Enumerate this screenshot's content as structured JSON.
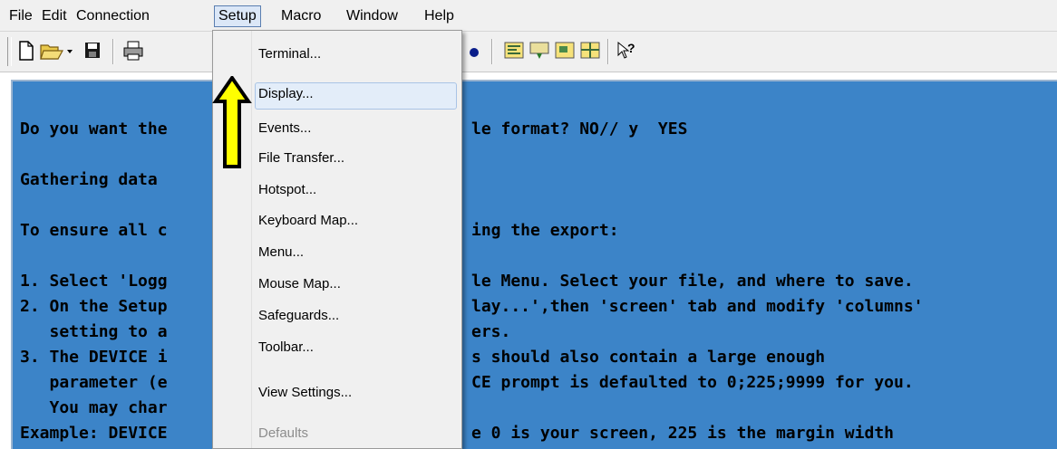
{
  "menubar": {
    "items": [
      "File",
      "Edit",
      "Connection",
      "Setup",
      "Macro",
      "Window",
      "Help"
    ],
    "active": "Setup"
  },
  "toolbar": {
    "icons": [
      "new-icon",
      "open-icon",
      "dropdown-arrow-icon",
      "save-icon",
      "print-icon",
      "dot-icon",
      "map-icon",
      "keyboard-icon",
      "hotspot-icon",
      "grid-icon",
      "help-pointer-icon"
    ],
    "help_glyph": "?"
  },
  "setup_menu": {
    "items": [
      {
        "label": "Terminal...",
        "enabled": true
      },
      {
        "label": "Display...",
        "enabled": true,
        "highlighted": true
      },
      {
        "label": "Events...",
        "enabled": true
      },
      {
        "label": "File Transfer...",
        "enabled": true
      },
      {
        "label": "Hotspot...",
        "enabled": true
      },
      {
        "label": "Keyboard Map...",
        "enabled": true
      },
      {
        "label": "Menu...",
        "enabled": true
      },
      {
        "label": "Mouse Map...",
        "enabled": true
      },
      {
        "label": "Safeguards...",
        "enabled": true
      },
      {
        "label": "Toolbar...",
        "enabled": true
      },
      {
        "label": "View Settings...",
        "enabled": true
      },
      {
        "label": "Defaults",
        "enabled": false
      }
    ]
  },
  "terminal": {
    "background": "#3c84c8",
    "lines": [
      {
        "left": "Do you want the",
        "right": "le format? NO// y  YES"
      },
      {
        "left": "Gathering data",
        "right": ""
      },
      {
        "left": "To ensure all c",
        "right": "ing the export:"
      },
      {
        "left": "1. Select 'Logg",
        "right": "le Menu. Select your file, and where to save."
      },
      {
        "left": "2. On the Setup",
        "right": "lay...',then 'screen' tab and modify 'columns'"
      },
      {
        "left": "   setting to a",
        "right": "ers."
      },
      {
        "left": "3. The DEVICE i",
        "right": "s should also contain a large enough"
      },
      {
        "left": "   parameter (e",
        "right": "CE prompt is defaulted to 0;225;9999 for you."
      },
      {
        "left": "   You may char",
        "right": ""
      },
      {
        "left": "Example: DEVICE",
        "right": "e 0 is your screen, 225 is the margin width"
      }
    ]
  },
  "annotation": {
    "arrow_color": "#ffff00"
  }
}
